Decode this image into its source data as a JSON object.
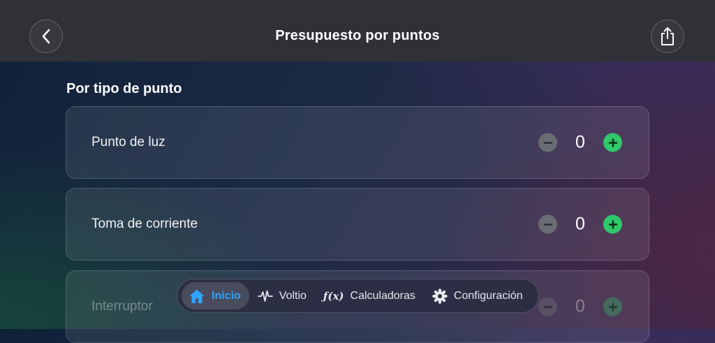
{
  "header": {
    "title": "Presupuesto por puntos",
    "back_icon": "chevron-left-icon",
    "share_icon": "share-icon"
  },
  "section": {
    "title": "Por tipo de punto"
  },
  "items": [
    {
      "label": "Punto de luz",
      "count": "0"
    },
    {
      "label": "Toma de corriente",
      "count": "0"
    },
    {
      "label": "Interruptor",
      "count": "0"
    }
  ],
  "tabbar": {
    "tabs": [
      {
        "label": "Inicio",
        "icon": "house-icon",
        "active": true
      },
      {
        "label": "Voltio",
        "icon": "waveform-icon",
        "active": false
      },
      {
        "label": "Calculadoras",
        "icon": "function-icon",
        "icon_text": "ƒ(x)",
        "active": false
      },
      {
        "label": "Configuración",
        "icon": "gear-icon",
        "active": false
      }
    ]
  },
  "colors": {
    "accent": "#2ea3ff",
    "plus": "#30c86a",
    "minus": "#6a6c74",
    "header": "#2f3137"
  }
}
